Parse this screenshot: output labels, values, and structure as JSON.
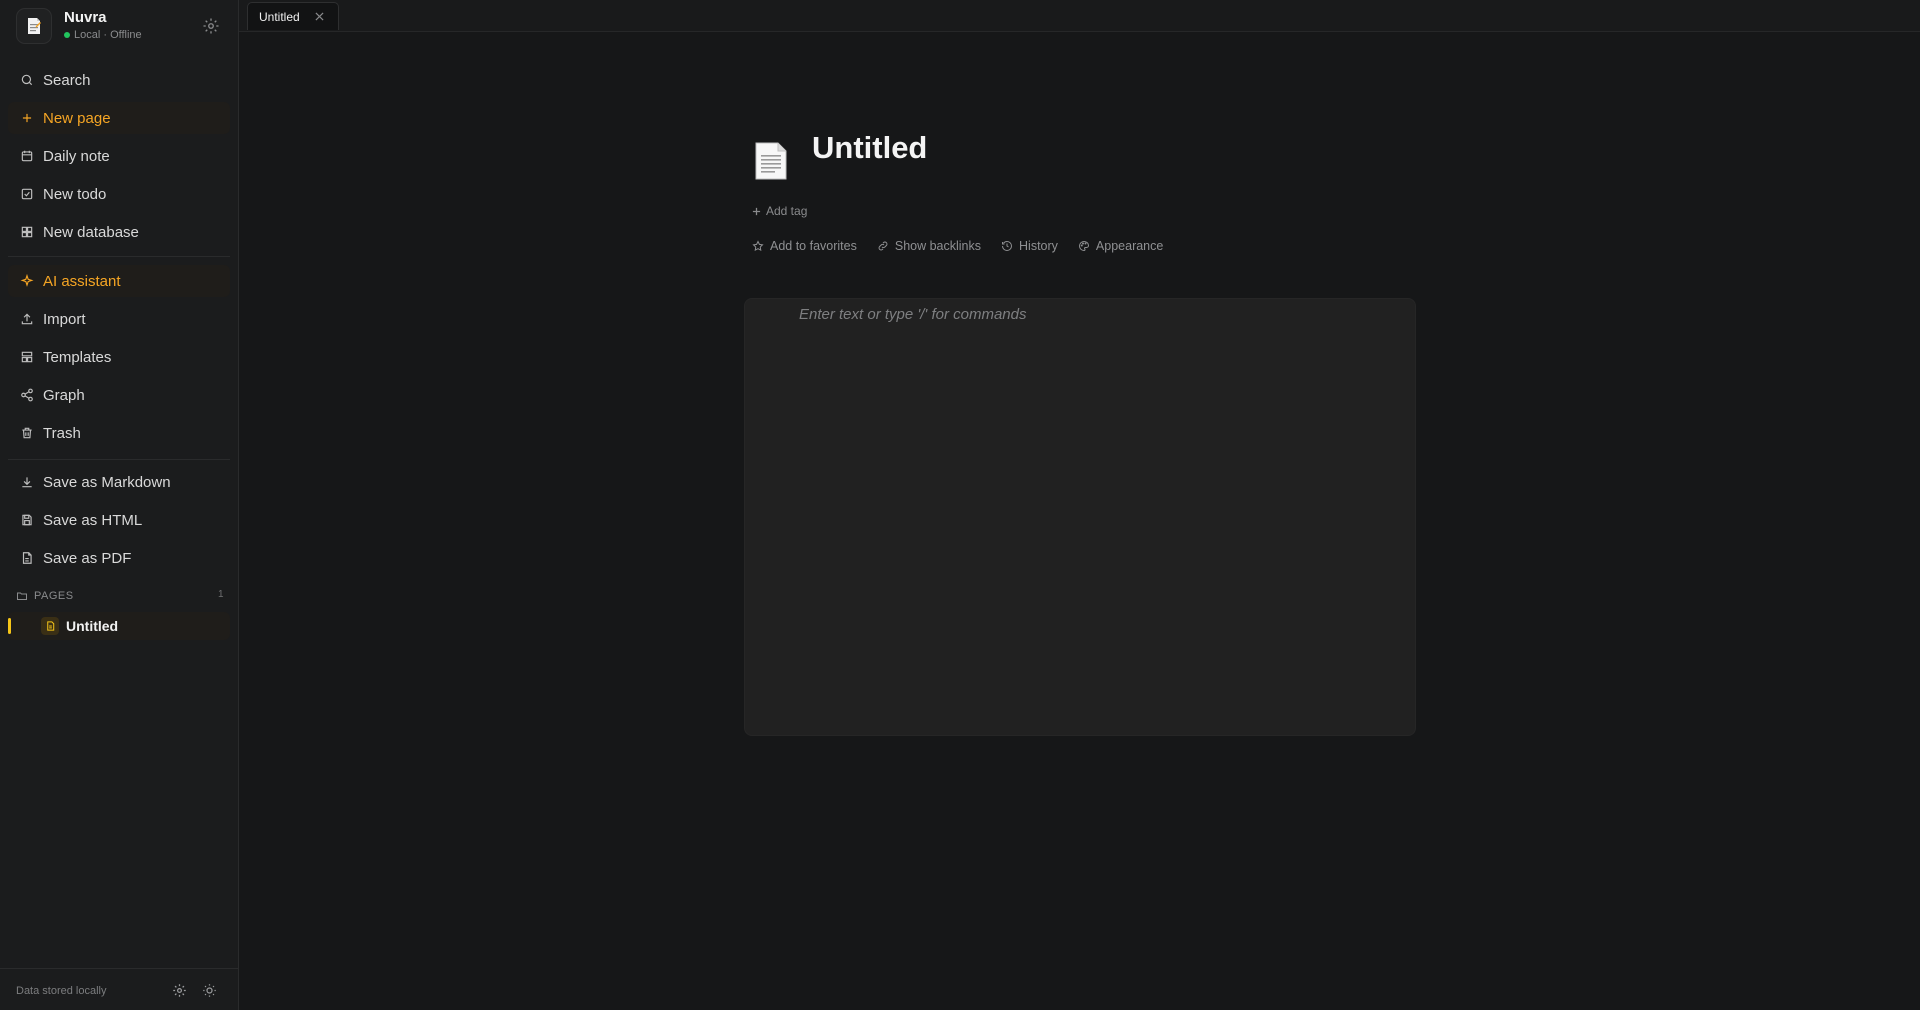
{
  "app": {
    "name": "Nuvra",
    "status": "Local · Offline",
    "status_color": "#22c55e",
    "accent_color": "#f5a524"
  },
  "sidebar": {
    "items": [
      {
        "label": "Search",
        "icon": "search-icon"
      },
      {
        "label": "New page",
        "icon": "plus-icon",
        "accent": true
      },
      {
        "label": "Daily note",
        "icon": "calendar-icon"
      },
      {
        "label": "New todo",
        "icon": "checkbox-icon"
      },
      {
        "label": "New database",
        "icon": "grid-icon"
      },
      {
        "label": "AI assistant",
        "icon": "sparkle-icon",
        "accent": true
      },
      {
        "label": "Import",
        "icon": "upload-icon"
      },
      {
        "label": "Templates",
        "icon": "template-icon"
      },
      {
        "label": "Graph",
        "icon": "share-icon"
      },
      {
        "label": "Trash",
        "icon": "trash-icon"
      },
      {
        "label": "Save as Markdown",
        "icon": "download-icon"
      },
      {
        "label": "Save as HTML",
        "icon": "save-icon"
      },
      {
        "label": "Save as PDF",
        "icon": "file-icon"
      }
    ],
    "pages_section": {
      "title": "PAGES",
      "count": "1",
      "pages": [
        {
          "label": "Untitled",
          "active": true
        }
      ]
    },
    "footer": {
      "text": "Data stored locally"
    }
  },
  "tabs": [
    {
      "label": "Untitled",
      "active": true
    }
  ],
  "editor": {
    "title": "Untitled",
    "add_tag": "Add tag",
    "actions": [
      {
        "label": "Add to favorites",
        "icon": "star-icon"
      },
      {
        "label": "Show backlinks",
        "icon": "link-icon"
      },
      {
        "label": "History",
        "icon": "history-icon"
      },
      {
        "label": "Appearance",
        "icon": "palette-icon"
      }
    ],
    "placeholder": "Enter text or type '/' for commands"
  }
}
